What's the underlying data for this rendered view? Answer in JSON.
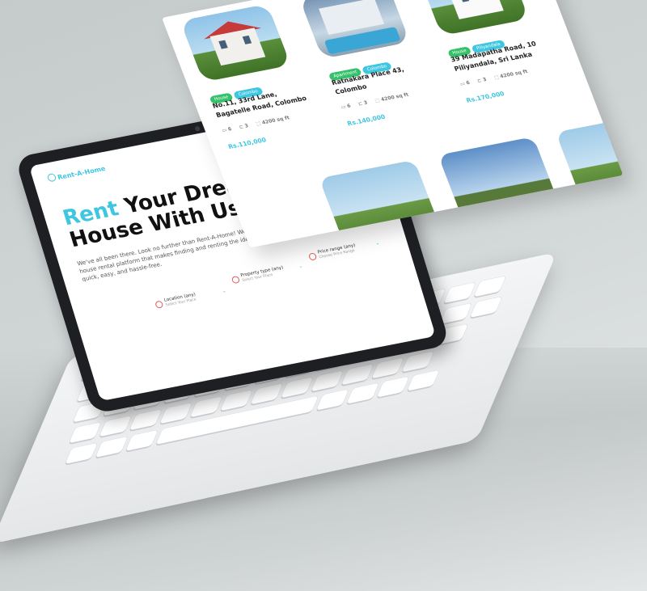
{
  "laptop": {
    "brand": "Rent-A-Home",
    "hero": {
      "title_accent": "Rent",
      "title_rest_line1": " Your Dream",
      "title_line2": "House With Us.",
      "description": "We've all been there. Look no further than Rent-A-Home! We're a revolutionary house rental platform that makes finding and renting the ideal hose for your needs quick, easy, and hassle-free."
    },
    "filters": [
      {
        "title": "Location (any)",
        "subtitle": "Select Your Place"
      },
      {
        "title": "Property type (any)",
        "subtitle": "Select Your Place"
      },
      {
        "title": "Price range (any)",
        "subtitle": "Choose Price Range"
      }
    ]
  },
  "listings": [
    {
      "tags": [
        "House",
        "Colombo"
      ],
      "address": "No.11, 33rd Lane, Bagatelle Road, Colombo",
      "beds": "6",
      "baths": "3",
      "area": "4200 sq ft",
      "price": "Rs.110,000"
    },
    {
      "tags": [
        "Apartment",
        "Colombo"
      ],
      "address": "Ratnakara Place 43, Colombo",
      "beds": "6",
      "baths": "3",
      "area": "4200 sq ft",
      "price": "Rs.140,000"
    },
    {
      "tags": [
        "House",
        "Piliyandala"
      ],
      "address": "39 Madapatha Road, 10 Piliyandala, Sri Lanka",
      "beds": "6",
      "baths": "3",
      "area": "4200 sq ft",
      "price": "Rs.170,000"
    }
  ],
  "colors": {
    "accent": "#3fc6e0",
    "tag_green": "#35c06a",
    "roof_red": "#c73a3a"
  },
  "icons": [
    "location-pin-icon",
    "home-icon",
    "price-tag-icon",
    "chevron-down-icon",
    "bed-icon",
    "bath-icon",
    "area-icon"
  ]
}
